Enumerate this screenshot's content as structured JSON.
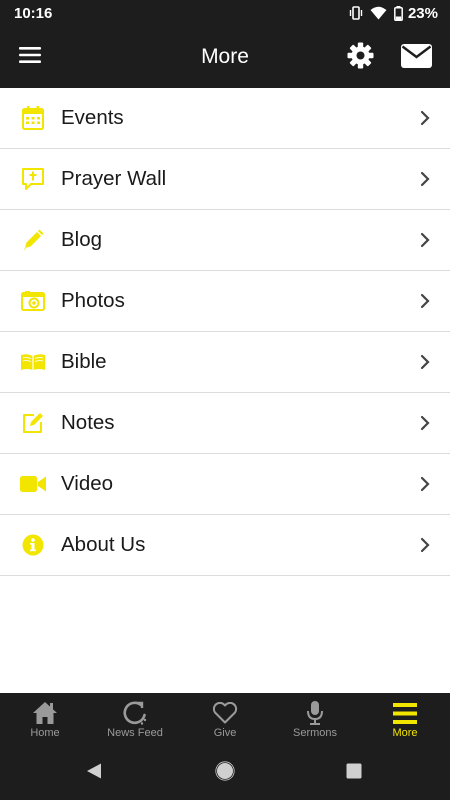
{
  "status_bar": {
    "time": "10:16",
    "battery_percent": "23%",
    "icons": [
      "vibrate-icon",
      "wifi-icon",
      "battery-icon"
    ]
  },
  "app_bar": {
    "title": "More",
    "left_icon": "menu-icon",
    "right_icons": [
      "gear-icon",
      "mail-icon"
    ]
  },
  "colors": {
    "accent": "#f2e500",
    "bar_background": "#1d1d1d",
    "inactive_nav": "#9a9a9a"
  },
  "menu": {
    "items": [
      {
        "label": "Events",
        "icon": "calendar-icon"
      },
      {
        "label": "Prayer Wall",
        "icon": "prayer-speech-icon"
      },
      {
        "label": "Blog",
        "icon": "pencil-icon"
      },
      {
        "label": "Photos",
        "icon": "camera-icon"
      },
      {
        "label": "Bible",
        "icon": "book-icon"
      },
      {
        "label": "Notes",
        "icon": "edit-note-icon"
      },
      {
        "label": "Video",
        "icon": "video-camera-icon"
      },
      {
        "label": "About Us",
        "icon": "info-icon"
      }
    ]
  },
  "bottom_nav": {
    "tabs": [
      {
        "label": "Home",
        "icon": "home-icon",
        "active": false
      },
      {
        "label": "News Feed",
        "icon": "news-feed-icon",
        "active": false
      },
      {
        "label": "Give",
        "icon": "heart-icon",
        "active": false
      },
      {
        "label": "Sermons",
        "icon": "microphone-icon",
        "active": false
      },
      {
        "label": "More",
        "icon": "more-icon",
        "active": true
      }
    ]
  },
  "system_nav": [
    "back-icon",
    "home-circle-icon",
    "recents-icon"
  ]
}
